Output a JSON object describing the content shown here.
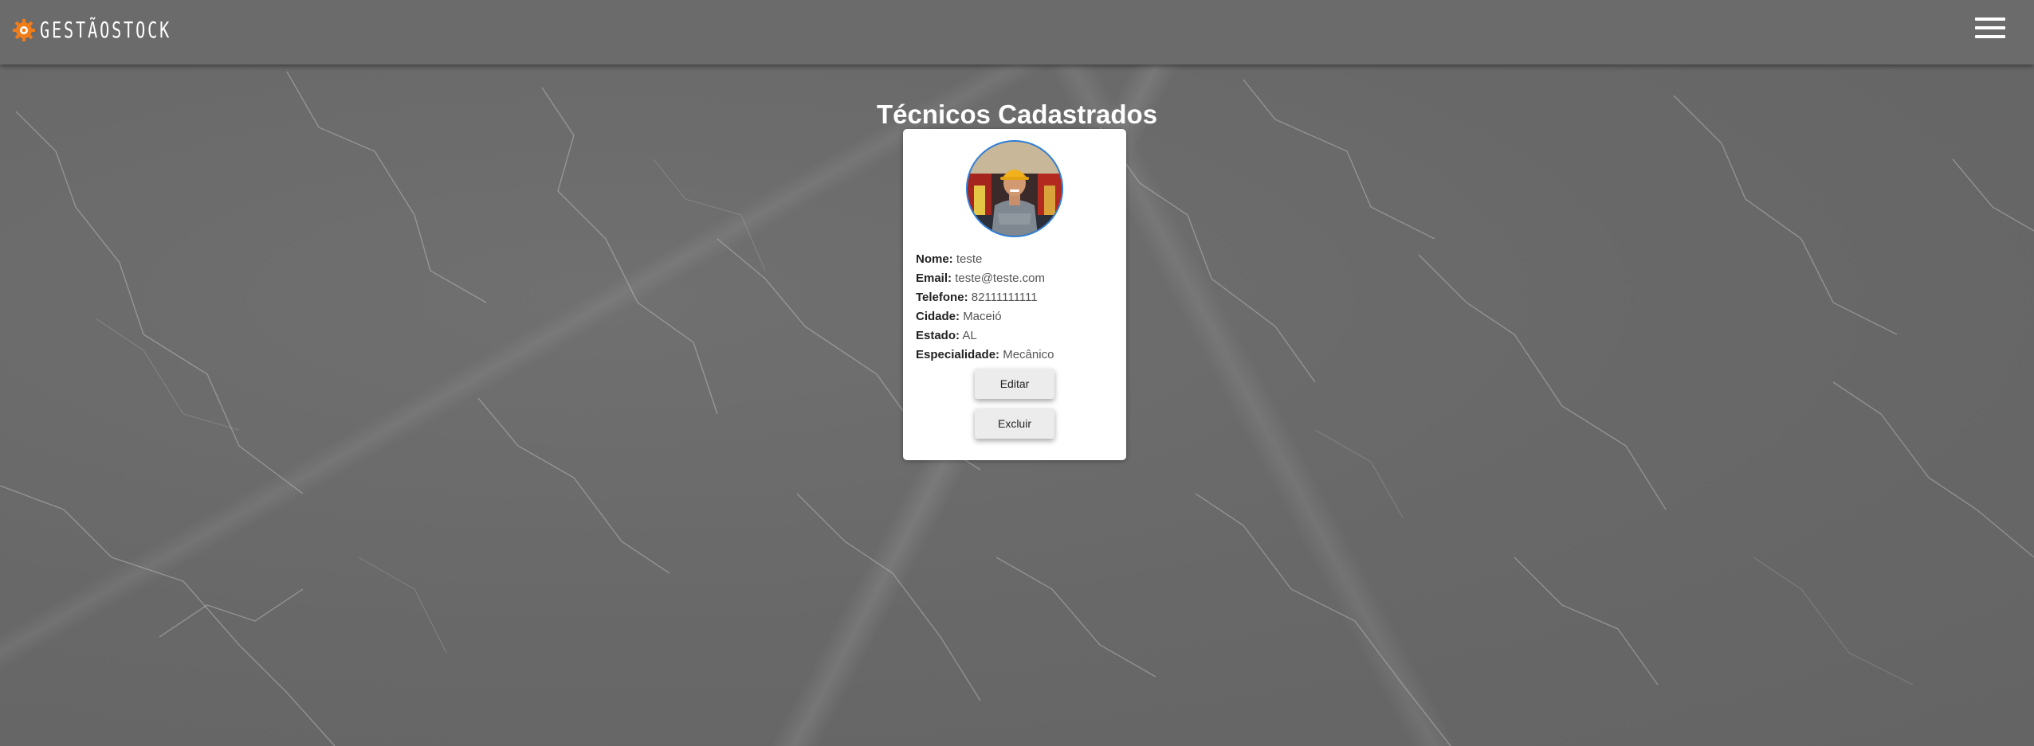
{
  "header": {
    "logo_text": "GESTÃOSTOCK",
    "logo_icon": "gear-icon",
    "menu_icon": "hamburger-menu-icon"
  },
  "page": {
    "title": "Técnicos Cadastrados"
  },
  "technician": {
    "name_label": "Nome:",
    "name": "teste",
    "email_label": "Email:",
    "email": "teste@teste.com",
    "phone_label": "Telefone:",
    "phone": "82111111111",
    "city_label": "Cidade:",
    "city": "Maceió",
    "state_label": "Estado:",
    "state": "AL",
    "specialty_label": "Especialidade:",
    "specialty": "Mecânico",
    "edit_label": "Editar",
    "delete_label": "Excluir"
  },
  "colors": {
    "background": "#6b6b6b",
    "logo_accent": "#f07d1a",
    "avatar_border": "#2b7fd9",
    "card": "#ffffff"
  }
}
